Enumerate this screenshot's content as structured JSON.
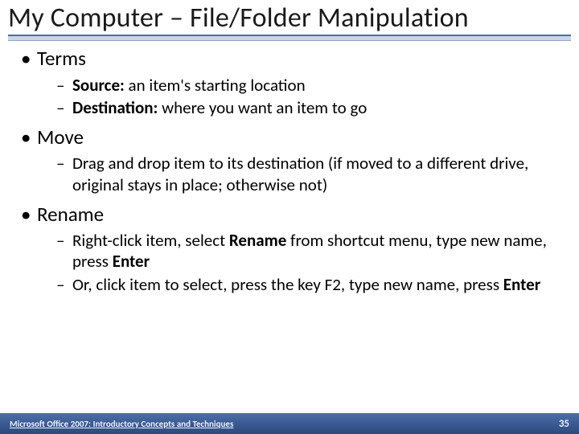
{
  "title": "My Computer – File/Folder Manipulation",
  "sections": [
    {
      "heading": "Terms",
      "items": [
        {
          "bold_lead": "Source:",
          "rest": "  an item's starting location"
        },
        {
          "bold_lead": "Destination:",
          "rest": "  where you want an item to go"
        }
      ]
    },
    {
      "heading": "Move",
      "items": [
        {
          "text": "Drag and drop item to its destination (if moved to a different drive, original stays in place; otherwise not)"
        }
      ]
    },
    {
      "heading": "Rename",
      "items": [
        {
          "parts": [
            "Right-click item, select ",
            {
              "b": "Rename"
            },
            " from shortcut menu, type new name, press ",
            {
              "b": "Enter"
            }
          ]
        },
        {
          "parts": [
            "Or, click item to select, press the key F2, type new name, press ",
            {
              "b": "Enter"
            }
          ]
        }
      ]
    }
  ],
  "footer": {
    "left": "Microsoft Office 2007: Introductory Concepts and Techniques",
    "page": "35"
  }
}
